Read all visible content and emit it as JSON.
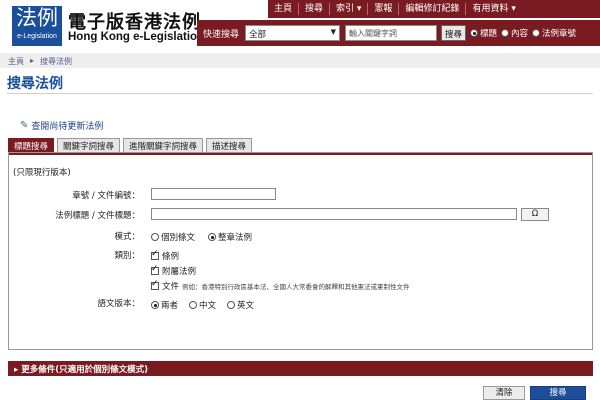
{
  "header": {
    "logo_main": "法例",
    "logo_sub": "e-Legislation",
    "title_zh": "電子版香港法例",
    "title_en": "Hong Kong e-Legislation"
  },
  "topnav": [
    "主頁",
    "搜尋",
    "索引 ▾",
    "憲報",
    "編輯修訂紀錄",
    "有用資料 ▾"
  ],
  "quick_search": {
    "label": "快速搜尋",
    "scope_value": "全部",
    "keyword_placeholder": "輸入關鍵字詞",
    "button": "搜尋",
    "radios": [
      {
        "label": "標題",
        "checked": true
      },
      {
        "label": "內容",
        "checked": false
      },
      {
        "label": "法例章號",
        "checked": false
      }
    ]
  },
  "breadcrumb": {
    "home": "主頁",
    "sep": "▸",
    "current": "搜尋法例"
  },
  "page_title": "搜尋法例",
  "latest_link": "查閱尚待更新法例",
  "tabs": [
    "標題搜尋",
    "關鍵字詞搜尋",
    "進階關鍵字詞搜尋",
    "描述搜尋"
  ],
  "form": {
    "note": "(只限現行版本)",
    "chapter_label": "章號 / 文件編號：",
    "title_label": "法例標題 / 文件標題：",
    "omega_button": "Ω",
    "mode_label": "模式：",
    "mode_options": [
      {
        "label": "個別條文",
        "checked": false
      },
      {
        "label": "整章法例",
        "checked": true
      }
    ],
    "category_label": "類別：",
    "categories": [
      {
        "label": "條例",
        "checked": true,
        "note": ""
      },
      {
        "label": "附屬法例",
        "checked": true,
        "note": ""
      },
      {
        "label": "文件",
        "checked": true,
        "note": "例如：香港特別行政區基本法、全國人大常委會的解釋和其他憲法或憲制性文件"
      }
    ],
    "language_label": "語文版本：",
    "language_options": [
      {
        "label": "兩者",
        "checked": true
      },
      {
        "label": "中文",
        "checked": false
      },
      {
        "label": "英文",
        "checked": false
      }
    ]
  },
  "more_conditions": "▸ 更多條件(只適用於個別條文模式)",
  "buttons": {
    "clear": "清除",
    "search": "搜尋"
  },
  "colors": {
    "brand": "#7a1b22",
    "accent_blue": "#1a4f9b"
  }
}
